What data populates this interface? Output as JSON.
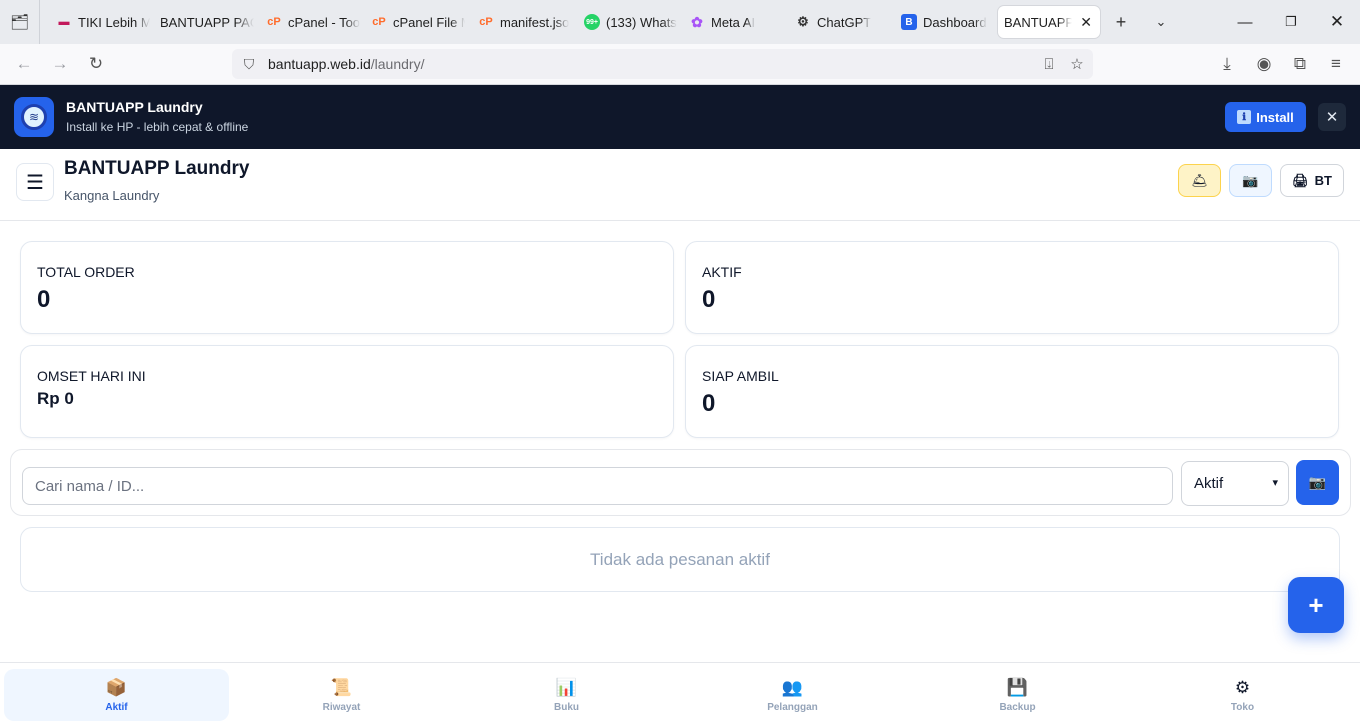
{
  "browser": {
    "tabs": [
      {
        "title": "TIKI Lebih M",
        "favicon": "tiki-icon",
        "color": "#c2185b"
      },
      {
        "title": "BANTUAPP PAG",
        "favicon": "blank-icon",
        "color": "#888888"
      },
      {
        "title": "cPanel - Too",
        "favicon": "cpanel-icon",
        "color": "#ff6c2c"
      },
      {
        "title": "cPanel File M",
        "favicon": "cpanel-icon",
        "color": "#ff6c2c"
      },
      {
        "title": "manifest.jso",
        "favicon": "cpanel-icon",
        "color": "#ff6c2c"
      },
      {
        "title": "(133) Whats",
        "favicon": "whatsapp-icon",
        "color": "#25d366",
        "badge": "99+"
      },
      {
        "title": "Meta AI",
        "favicon": "meta-ai-icon",
        "color": "#a855f7"
      },
      {
        "title": "ChatGPT",
        "favicon": "chatgpt-icon",
        "color": "#333333"
      },
      {
        "title": "Dashboard",
        "favicon": "dashboard-icon",
        "color": "#2563eb"
      },
      {
        "title": "BANTUAPP L",
        "favicon": "blank-icon",
        "color": "#888888",
        "active": true
      }
    ],
    "url_host": "bantuapp.web.id",
    "url_path": "/laundry/"
  },
  "banner": {
    "title": "BANTUAPP Laundry",
    "subtitle": "Install ke HP - lebih cepat & offline",
    "install_label": "Install",
    "close_label": "✕"
  },
  "header": {
    "title": "BANTUAPP Laundry",
    "subtitle": "Kangna Laundry",
    "bt_label": "BT"
  },
  "stats": [
    {
      "label": "TOTAL ORDER",
      "value": "0"
    },
    {
      "label": "AKTIF",
      "value": "0"
    },
    {
      "label": "OMSET HARI INI",
      "value": "Rp 0"
    },
    {
      "label": "SIAP AMBIL",
      "value": "0"
    }
  ],
  "search": {
    "placeholder": "Cari nama / ID...",
    "filter_value": "Aktif"
  },
  "empty_message": "Tidak ada pesanan aktif",
  "fab_label": "+",
  "bottom_nav": [
    {
      "label": "Aktif",
      "icon": "package-icon",
      "active": true
    },
    {
      "label": "Riwayat",
      "icon": "scroll-icon"
    },
    {
      "label": "Buku",
      "icon": "chart-icon"
    },
    {
      "label": "Pelanggan",
      "icon": "users-icon"
    },
    {
      "label": "Backup",
      "icon": "floppy-icon"
    },
    {
      "label": "Toko",
      "icon": "gear-icon"
    }
  ],
  "colors": {
    "primary": "#2563eb",
    "banner_bg": "#0f172a",
    "muted": "#94a3b8"
  }
}
